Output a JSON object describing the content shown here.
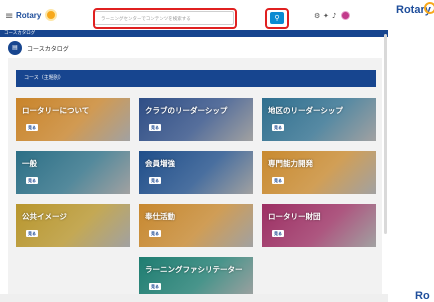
{
  "app": {
    "brand": "Rotary",
    "breadcrumb": "コースカタログ",
    "page_title": "コースカタログ",
    "search_placeholder": "ラーニングセンターでコンテンツを検索する",
    "search_button_icon": "search-icon",
    "menu_icon": "hamburger-icon",
    "header_icons": [
      "settings-icon",
      "pin-icon",
      "bell-icon",
      "avatar"
    ]
  },
  "section": {
    "label": "コース（主題別）"
  },
  "tiles": [
    {
      "title": "ロータリーについて",
      "button": "見る",
      "color": "#c9842a"
    },
    {
      "title": "クラブのリーダーシップ",
      "button": "見る",
      "color": "#2f4e86"
    },
    {
      "title": "地区のリーダーシップ",
      "button": "見る",
      "color": "#2f6f8f"
    },
    {
      "title": "一般",
      "button": "見る",
      "color": "#2c6f86"
    },
    {
      "title": "会員増強",
      "button": "見る",
      "color": "#1f4e8a"
    },
    {
      "title": "専門能力開発",
      "button": "見る",
      "color": "#c98a2f"
    },
    {
      "title": "公共イメージ",
      "button": "見る",
      "color": "#b8962d"
    },
    {
      "title": "奉仕活動",
      "button": "見る",
      "color": "#c7882f"
    },
    {
      "title": "ロータリー財団",
      "button": "見る",
      "color": "#9c2f63"
    },
    {
      "title": "ラーニングファシリテーター",
      "button": "見る",
      "color": "#1e7d71"
    }
  ],
  "outer": {
    "side_brand": "Rotary",
    "bottom_brand": "Ro"
  },
  "colors": {
    "primary": "#17458f",
    "accent": "#0a8ad1",
    "highlight": "#e02020",
    "gold": "#f7a81b"
  }
}
